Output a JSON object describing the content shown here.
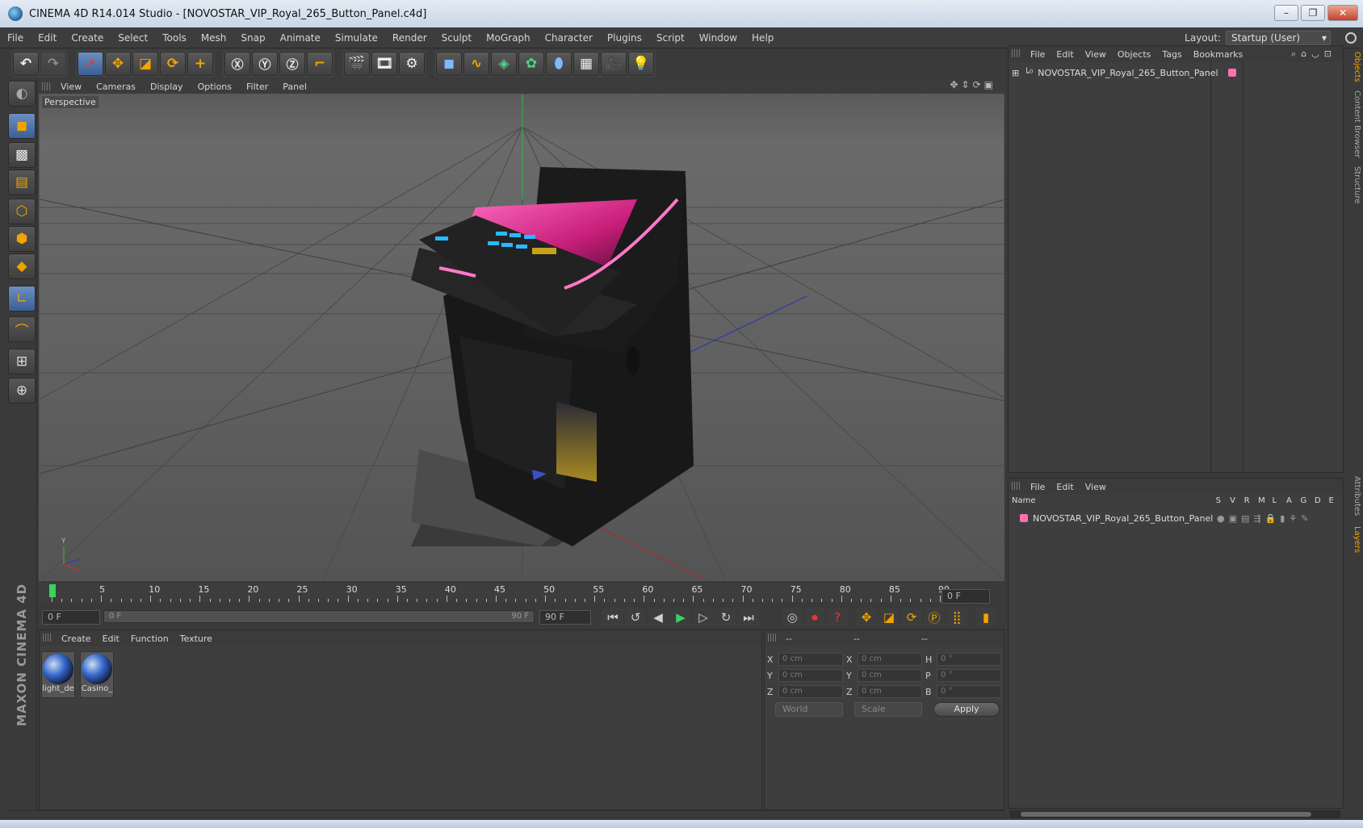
{
  "window": {
    "title": "CINEMA 4D R14.014 Studio - [NOVOSTAR_VIP_Royal_265_Button_Panel.c4d]"
  },
  "menubar": [
    "File",
    "Edit",
    "Create",
    "Select",
    "Tools",
    "Mesh",
    "Snap",
    "Animate",
    "Simulate",
    "Render",
    "Sculpt",
    "MoGraph",
    "Character",
    "Plugins",
    "Script",
    "Window",
    "Help"
  ],
  "layout": {
    "label": "Layout:",
    "value": "Startup (User)"
  },
  "viewport": {
    "menu": [
      "View",
      "Cameras",
      "Display",
      "Options",
      "Filter",
      "Panel"
    ],
    "label": "Perspective"
  },
  "timeline": {
    "ticks": [
      "0",
      "5",
      "10",
      "15",
      "20",
      "25",
      "30",
      "35",
      "40",
      "45",
      "50",
      "55",
      "60",
      "65",
      "70",
      "75",
      "80",
      "85",
      "90"
    ],
    "current_frame": "0 F",
    "start_field": "0 F",
    "range_start": "0 F",
    "range_end": "90 F",
    "end_field": "90 F"
  },
  "materials": {
    "menu": [
      "Create",
      "Edit",
      "Function",
      "Texture"
    ],
    "items": [
      {
        "name": "light_de"
      },
      {
        "name": "Casino_"
      }
    ]
  },
  "coords": {
    "headers": [
      "--",
      "--",
      "--"
    ],
    "rows": [
      {
        "a": "X",
        "av": "0 cm",
        "b": "X",
        "bv": "0 cm",
        "c": "H",
        "cv": "0 °"
      },
      {
        "a": "Y",
        "av": "0 cm",
        "b": "Y",
        "bv": "0 cm",
        "c": "P",
        "cv": "0 °"
      },
      {
        "a": "Z",
        "av": "0 cm",
        "b": "Z",
        "bv": "0 cm",
        "c": "B",
        "cv": "0 °"
      }
    ],
    "world": "World",
    "scale": "Scale",
    "apply": "Apply"
  },
  "objects": {
    "menu": [
      "File",
      "Edit",
      "View",
      "Objects",
      "Tags",
      "Bookmarks"
    ],
    "root": "NOVOSTAR_VIP_Royal_265_Button_Panel"
  },
  "layers": {
    "menu": [
      "File",
      "Edit",
      "View"
    ],
    "cols": [
      "Name",
      "S",
      "V",
      "R",
      "M",
      "L",
      "A",
      "G",
      "D",
      "E"
    ],
    "row": "NOVOSTAR_VIP_Royal_265_Button_Panel"
  },
  "sidetabs": [
    "Objects",
    "Content Browser",
    "Structure",
    "Attributes",
    "Layers"
  ],
  "brand": "MAXON CINEMA 4D",
  "colors": {
    "accent": "#f0a400",
    "layer_color": "#ff6fb4",
    "neon": "#ff79c8",
    "screen": "#c81f7a"
  }
}
